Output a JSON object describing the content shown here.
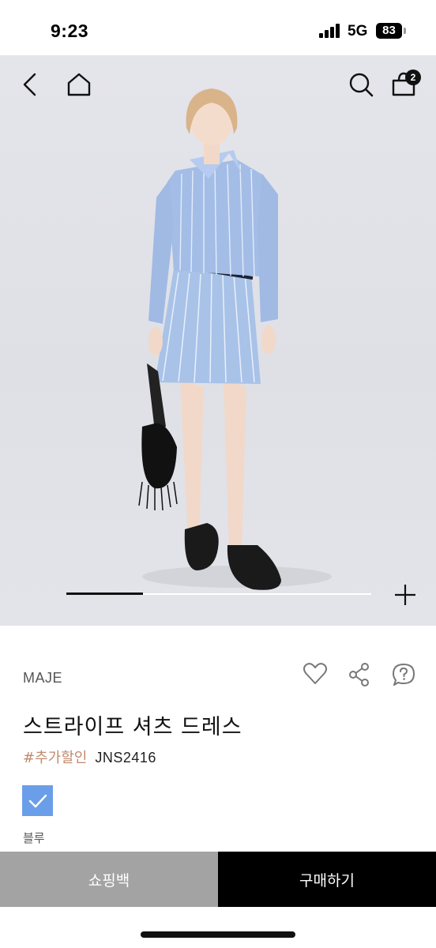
{
  "status_bar": {
    "time": "9:23",
    "network": "5G",
    "battery": "83"
  },
  "header": {
    "cart_count": "2"
  },
  "gallery": {
    "progress": 0.25
  },
  "product": {
    "brand": "MAJE",
    "name": "스트라이프 셔츠 드레스",
    "tag": "#추가할인",
    "code": "JNS2416",
    "color_label": "블루",
    "swatch_color": "#6b9ee8"
  },
  "actions": {
    "cart_button": "쇼핑백",
    "buy_button": "구매하기"
  },
  "icons": [
    "back-icon",
    "home-icon",
    "search-icon",
    "shopping-bag-icon",
    "plus-icon",
    "heart-icon",
    "share-icon",
    "question-icon",
    "check-icon"
  ]
}
